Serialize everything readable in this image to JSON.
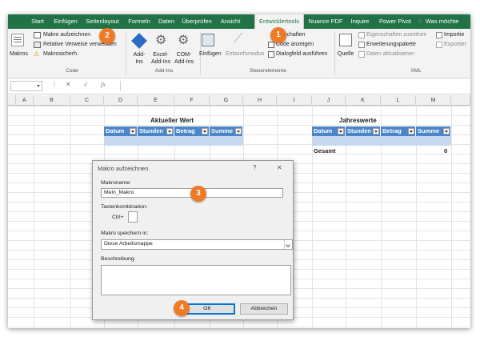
{
  "ribbon_tabs": [
    "Start",
    "Einfügen",
    "Seitenlayout",
    "Formeln",
    "Daten",
    "Überprüfen",
    "Ansicht",
    "Entwicklertools",
    "Nuance PDF",
    "Inquire",
    "Power Pivot",
    "Was möchte"
  ],
  "active_tab": "Entwicklertools",
  "help_icon": "lightbulb-icon",
  "code_group": {
    "label": "Code",
    "macros": "Makros",
    "record_macro": "Makro aufzeichnen",
    "relative_refs": "Relative Verweise verwenden",
    "macro_security": "Makrosicherh."
  },
  "addins_group": {
    "label": "Add-Ins",
    "addins": "Add-Ins",
    "excel_addins": "Excel-Add-Ins",
    "com_addins": "COM-Add-Ins"
  },
  "controls_group": {
    "label": "Steuerelemente",
    "insert": "Einfügen",
    "design_mode": "Entwurfsmodus",
    "properties": "schaften",
    "view_code": "Code anzeigen",
    "run_dialog": "Dialogfeld ausführen"
  },
  "xml_group": {
    "label": "XML",
    "source": "Quelle",
    "map_properties": "Eigenschaften zuordnen",
    "expansion_packs": "Erweiterungspakete",
    "refresh_data": "Daten aktualisieren",
    "import": "Importie",
    "export": "Exportier"
  },
  "formula_bar": {
    "fx": "fx",
    "cancel": "✕",
    "confirm": "✓",
    "dots": "⋮"
  },
  "column_headers": [
    "A",
    "B",
    "C",
    "D",
    "E",
    "F",
    "G",
    "H",
    "I",
    "J",
    "K",
    "L",
    "M"
  ],
  "sheet": {
    "left_title": "Aktueller Wert",
    "right_title": "Jahreswerte",
    "left_headers": [
      "Datum",
      "Stunden",
      "Betrag",
      "Summe"
    ],
    "right_headers": [
      "Datum",
      "Stunden",
      "Betrag",
      "Summe"
    ],
    "total_label": "Gesamt",
    "total_value": "0"
  },
  "dialog": {
    "title": "Makro aufzeichnen",
    "help": "?",
    "close": "✕",
    "macro_name_label": "Makroname:",
    "macro_name_value": "Mein_Makro",
    "shortcut_label": "Tastenkombination:",
    "ctrl_label": "Ctrl+",
    "store_label": "Makro speichern in:",
    "store_value": "Diese Arbeitsmappe",
    "description_label": "Beschreibung:",
    "ok": "OK",
    "cancel": "Abbrechen"
  },
  "callouts": [
    "1",
    "2",
    "3",
    "4"
  ]
}
